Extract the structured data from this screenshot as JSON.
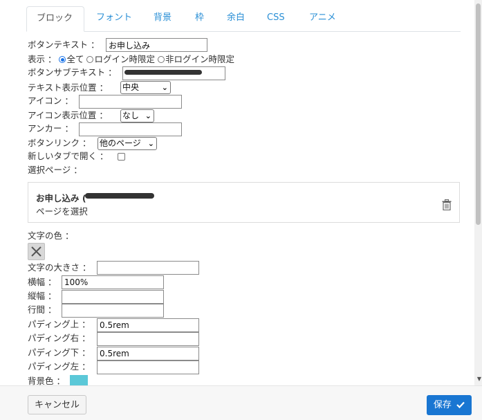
{
  "tabs": [
    {
      "label": "ブロック",
      "active": true
    },
    {
      "label": "フォント"
    },
    {
      "label": "背景"
    },
    {
      "label": "枠"
    },
    {
      "label": "余白"
    },
    {
      "label": "CSS"
    },
    {
      "label": "アニメ"
    }
  ],
  "form": {
    "button_text": {
      "label": "ボタンテキスト ：",
      "value": "お申し込み"
    },
    "display": {
      "label": "表示 ：",
      "options": [
        {
          "label": "全て",
          "selected": true
        },
        {
          "label": "ログイン時限定",
          "selected": false
        },
        {
          "label": "非ログイン時限定",
          "selected": false
        }
      ]
    },
    "button_subtext": {
      "label": "ボタンサブテキスト ：",
      "value": ""
    },
    "text_position": {
      "label": "テキスト表示位置 ：",
      "selected": "中央"
    },
    "icon": {
      "label": "アイコン ：",
      "value": ""
    },
    "icon_position": {
      "label": "アイコン表示位置 ：",
      "selected": "なし"
    },
    "anchor": {
      "label": "アンカー ：",
      "value": ""
    },
    "button_link": {
      "label": "ボタンリンク ：",
      "selected": "他のページ"
    },
    "new_tab": {
      "label": "新しいタブで開く ：",
      "checked": false
    },
    "select_page": {
      "label": "選択ページ ："
    }
  },
  "page_card": {
    "title": "お申し込み (",
    "subtitle": "ページを選択"
  },
  "style": {
    "text_color": {
      "label": "文字の色 ："
    },
    "text_size": {
      "label": "文字の大きさ ：",
      "value": ""
    },
    "width": {
      "label": "横幅 ：",
      "value": "100%"
    },
    "height": {
      "label": "縦幅 ：",
      "value": ""
    },
    "line_height": {
      "label": "行間 ：",
      "value": ""
    },
    "padding_top": {
      "label": "パディング上 ：",
      "value": "0.5rem"
    },
    "padding_right": {
      "label": "パディング右 ：",
      "value": ""
    },
    "padding_bottom": {
      "label": "パディング下 ：",
      "value": "0.5rem"
    },
    "padding_left": {
      "label": "パディング左 ：",
      "value": ""
    },
    "background": {
      "label": "背景色 ：",
      "color": "#5bc8d8"
    }
  },
  "footer": {
    "cancel": "キャンセル",
    "save": "保存"
  },
  "colors": {
    "accent": "#1976d2",
    "tab_link": "#2a8fd6"
  }
}
